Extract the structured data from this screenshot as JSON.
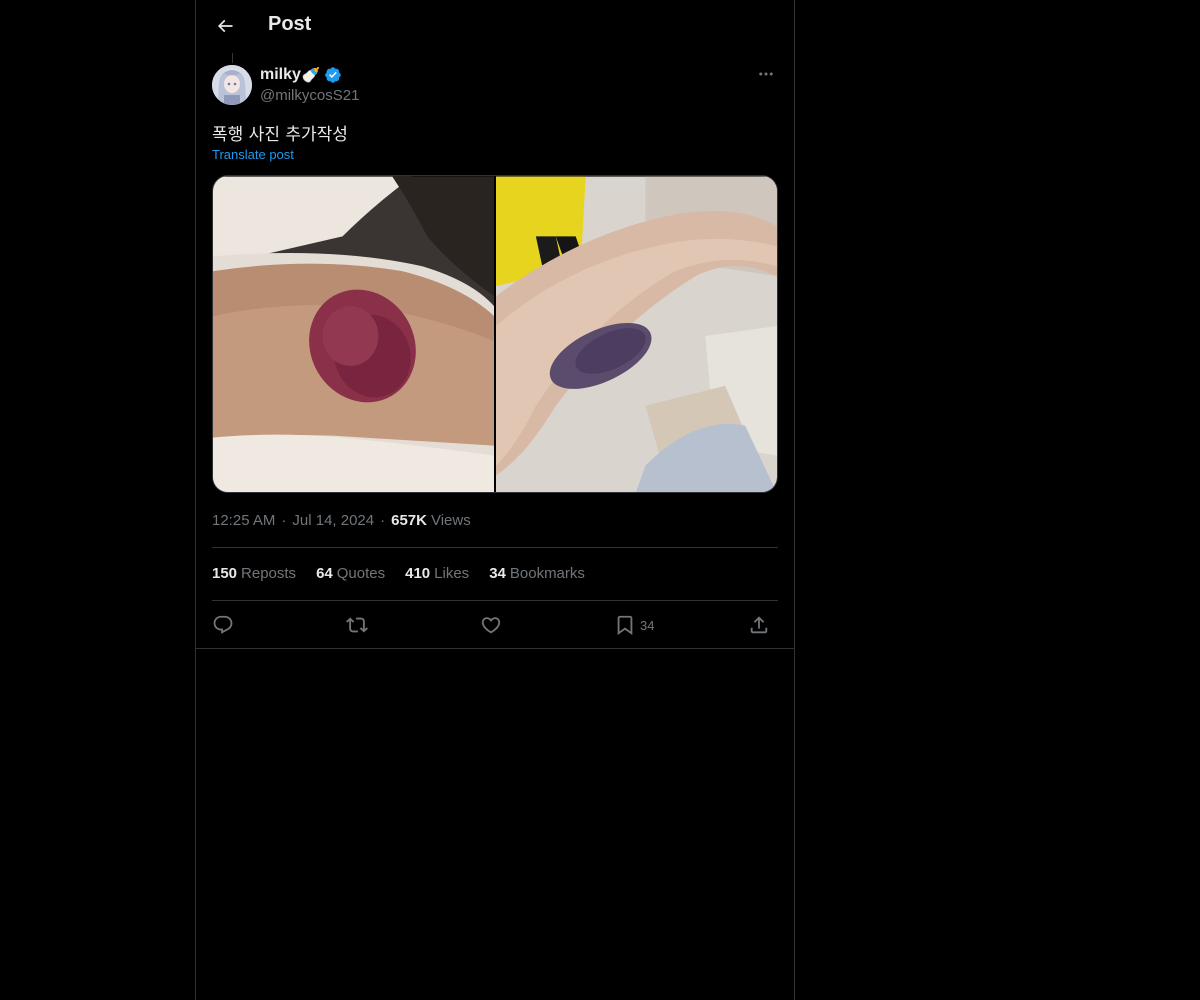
{
  "header": {
    "title": "Post"
  },
  "post": {
    "author_name": "milky",
    "author_emoji": "🍼",
    "author_handle": "@milkycosS21",
    "text": "폭행 사진 추가작성",
    "translate_label": "Translate post",
    "time": "12:25 AM",
    "date": "Jul 14, 2024",
    "views_count": "657K",
    "views_label": "Views",
    "stats": {
      "reposts_count": "150",
      "reposts_label": "Reposts",
      "quotes_count": "64",
      "quotes_label": "Quotes",
      "likes_count": "410",
      "likes_label": "Likes",
      "bookmarks_count": "34",
      "bookmarks_label": "Bookmarks"
    },
    "actions": {
      "bookmark_count": "34"
    }
  },
  "colors": {
    "background": "#000000",
    "text_primary": "#e7e9ea",
    "text_secondary": "#71767b",
    "accent": "#1d9bf0",
    "border": "#2f3336"
  },
  "icons": {
    "back": "arrow-left-icon",
    "verified": "verified-badge-icon",
    "more": "more-horizontal-icon",
    "reply": "reply-icon",
    "repost": "repost-icon",
    "like": "heart-icon",
    "bookmark": "bookmark-icon",
    "share": "share-icon"
  }
}
